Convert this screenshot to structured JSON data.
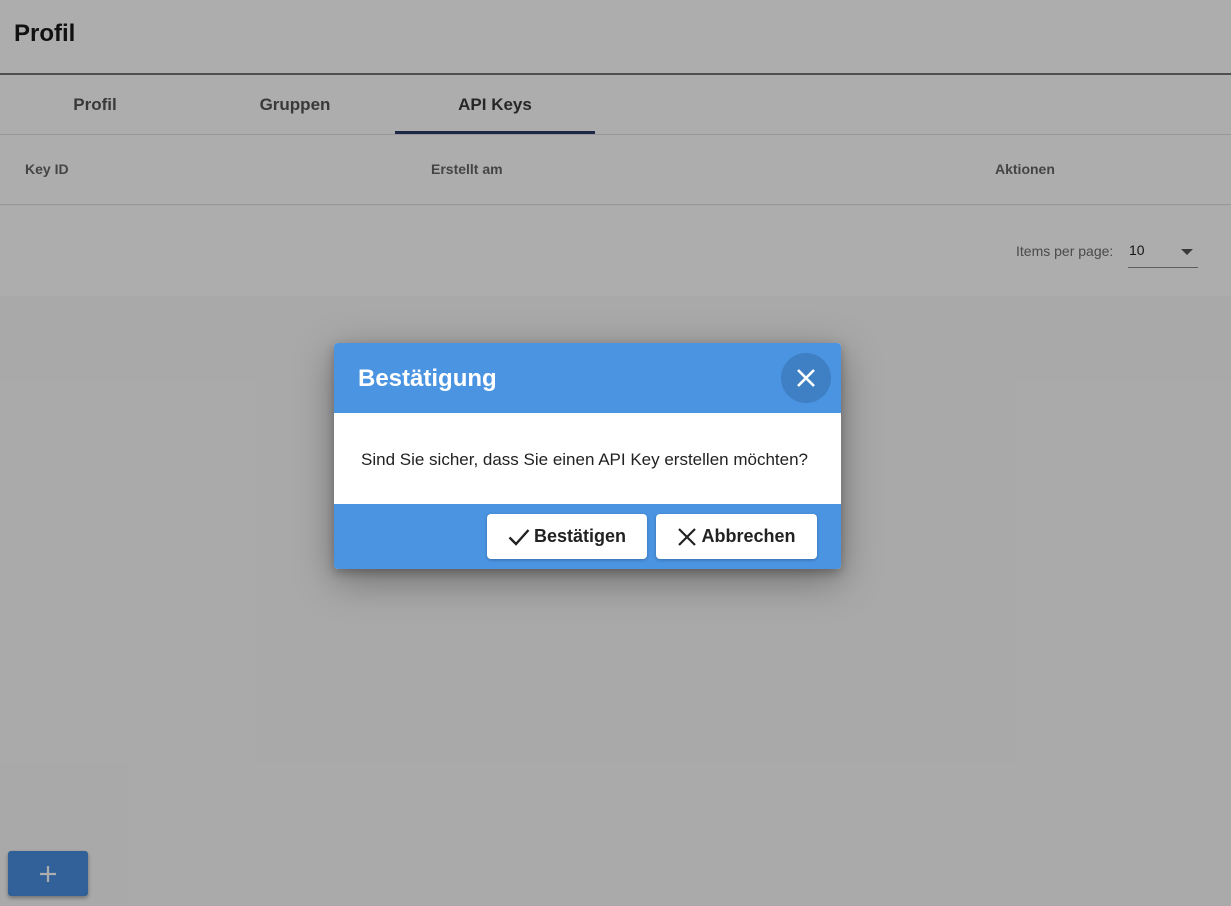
{
  "page": {
    "title": "Profil"
  },
  "tabs": [
    {
      "label": "Profil"
    },
    {
      "label": "Gruppen"
    },
    {
      "label": "API Keys",
      "active": true
    }
  ],
  "table": {
    "columns": [
      "Key ID",
      "Erstellt am",
      "Aktionen"
    ],
    "rows": []
  },
  "paginator": {
    "label": "Items per page:",
    "page_size": "10"
  },
  "fab": {
    "icon": "plus-icon"
  },
  "dialog": {
    "title": "Bestätigung",
    "close_icon": "close-icon",
    "message": "Sind Sie sicher, dass Sie einen API Key erstellen möchten?",
    "confirm_label": "Bestätigen",
    "confirm_icon": "check-icon",
    "cancel_label": "Abbrechen",
    "cancel_icon": "close-icon"
  },
  "colors": {
    "accent": "#4a94e2",
    "tab_ink": "#2b3a67",
    "backdrop": "rgba(0,0,0,0.32)"
  }
}
